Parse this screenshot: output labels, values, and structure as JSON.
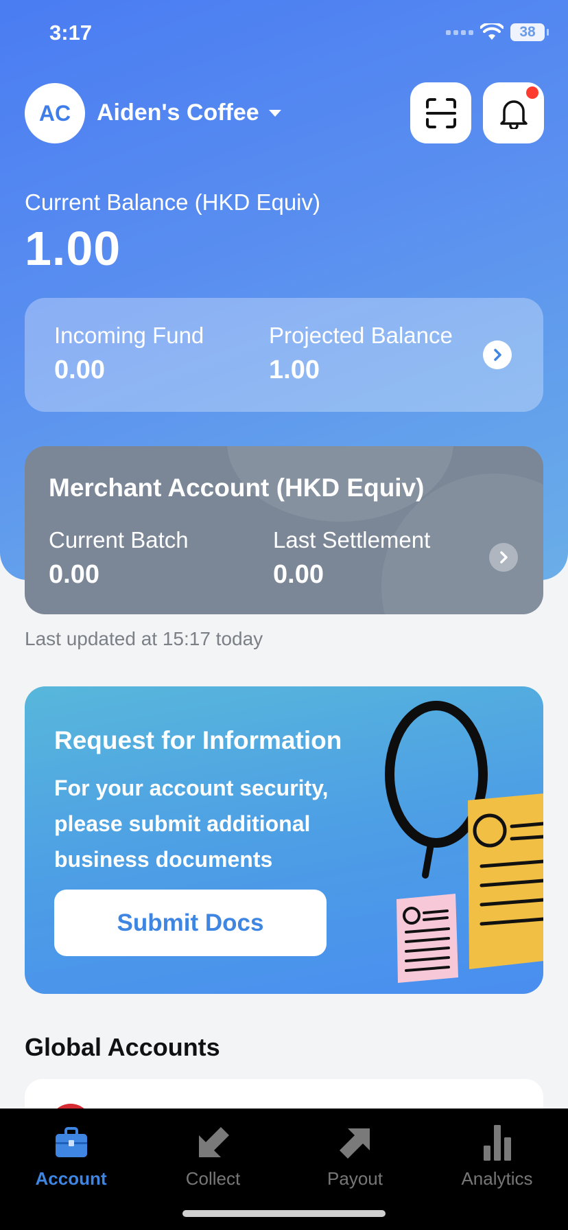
{
  "status_bar": {
    "time": "3:17",
    "battery": "38"
  },
  "header": {
    "avatar_initials": "AC",
    "merchant_name": "Aiden's Coffee",
    "scan_icon": "scan-icon",
    "notification_icon": "bell-icon",
    "has_notification": true
  },
  "balance": {
    "label": "Current Balance (HKD Equiv)",
    "value": "1.00"
  },
  "funds": {
    "incoming_label": "Incoming Fund",
    "incoming_value": "0.00",
    "projected_label": "Projected Balance",
    "projected_value": "1.00"
  },
  "merchant_account": {
    "title": "Merchant Account (HKD Equiv)",
    "current_batch_label": "Current Batch",
    "current_batch_value": "0.00",
    "last_settlement_label": "Last Settlement",
    "last_settlement_value": "0.00"
  },
  "last_updated": "Last updated at 15:17 today",
  "rfi": {
    "title": "Request for Information",
    "body": "For your account security, please submit additional business documents",
    "button_label": "Submit Docs"
  },
  "global_accounts": {
    "title": "Global Accounts"
  },
  "tabbar": {
    "tabs": [
      {
        "label": "Account",
        "icon": "briefcase-icon",
        "active": true
      },
      {
        "label": "Collect",
        "icon": "arrow-down-left-icon",
        "active": false
      },
      {
        "label": "Payout",
        "icon": "arrow-up-right-icon",
        "active": false
      },
      {
        "label": "Analytics",
        "icon": "bar-chart-icon",
        "active": false
      }
    ]
  },
  "colors": {
    "brand_blue": "#3f86e3",
    "hero_gradient_start": "#4a7cf2",
    "hero_gradient_end": "#6aaee8",
    "merchant_card": "#7b8797",
    "notification_dot": "#ff3b30"
  }
}
